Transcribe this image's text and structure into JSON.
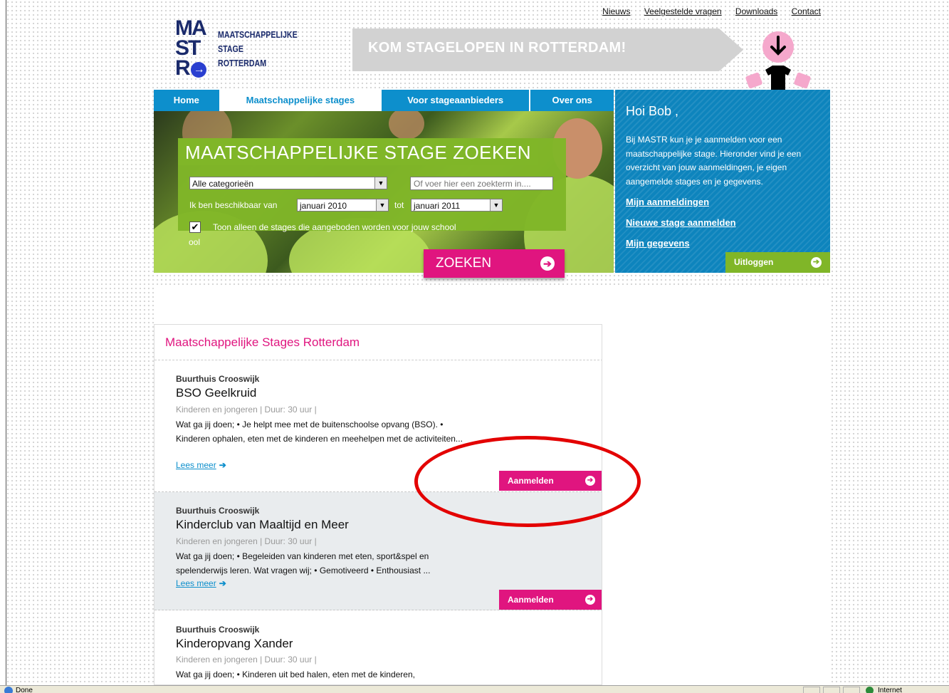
{
  "top_links": [
    "Nieuws",
    "Veelgestelde vragen",
    "Downloads",
    "Contact"
  ],
  "logo": {
    "mark_lines": [
      "MA",
      "ST",
      "R"
    ],
    "text_lines": [
      "MAATSCHAPPELIJKE",
      "STAGE",
      "ROTTERDAM"
    ]
  },
  "banner": {
    "text": "KOM STAGELOPEN IN ROTTERDAM!"
  },
  "nav": {
    "items": [
      "Home",
      "Maatschappelijke stages",
      "Voor stageaanbieders",
      "Over ons"
    ],
    "active": "Maatschappelijke stages"
  },
  "search": {
    "title": "MAATSCHAPPELIJKE STAGE ZOEKEN",
    "category_value": "Alle categorieën",
    "term_placeholder": "Of voer hier een zoekterm in....",
    "available_label": "Ik ben beschikbaar van",
    "from_value": "januari 2010",
    "to_label": "tot",
    "to_value": "januari 2011",
    "checkbox_label": "Toon alleen de stages die aangeboden worden voor jouw school",
    "checkbox_overflow": "ool",
    "checkbox_checked": true,
    "button_label": "ZOEKEN"
  },
  "sidebar": {
    "greeting": "Hoi Bob ,",
    "text": "Bij MASTR kun je je aanmelden voor een maatschappelijke stage. Hieronder vind je een overzicht van jouw aanmeldingen, je eigen aangemelde stages en je gegevens.",
    "links": [
      "Mijn aanmeldingen",
      "Nieuwe stage aanmelden",
      "Mijn gegevens"
    ],
    "logout_label": "Uitloggen"
  },
  "results": {
    "title": "Maatschappelijke Stages Rotterdam",
    "items": [
      {
        "organization": "Buurthuis Crooswijk",
        "title": "BSO Geelkruid",
        "meta": "Kinderen en jongeren | Duur: 30 uur |",
        "description": "Wat ga jij doen; • Je helpt mee met de buitenschoolse opvang (BSO). • Kinderen ophalen, eten met de kinderen en meehelpen met de activiteiten...",
        "read_more": "Lees meer",
        "apply": "Aanmelden"
      },
      {
        "organization": "Buurthuis Crooswijk",
        "title": "Kinderclub van Maaltijd en Meer",
        "meta": "Kinderen en jongeren | Duur: 30 uur |",
        "description": "Wat ga jij doen; • Begeleiden van kinderen met eten, sport&spel en spelenderwijs leren. Wat vragen wij; • Gemotiveerd • Enthousiast ...",
        "read_more": "Lees meer",
        "apply": "Aanmelden"
      },
      {
        "organization": "Buurthuis Crooswijk",
        "title": "Kinderopvang Xander",
        "meta": "Kinderen en jongeren | Duur: 30 uur |",
        "description": "Wat ga jij doen; • Kinderen uit bed halen, eten met de kinderen,"
      }
    ]
  },
  "statusbar": {
    "left": "Done",
    "right": "Internet"
  },
  "colors": {
    "pink": "#e0157f",
    "blue": "#0d8fcc",
    "green": "#80b628",
    "annotation": "#e30000"
  },
  "icons": [
    "arrow-right-circle-icon",
    "arrow-right-icon",
    "down-arrow-icon",
    "checkmark-icon",
    "ie-icon",
    "globe-icon"
  ]
}
